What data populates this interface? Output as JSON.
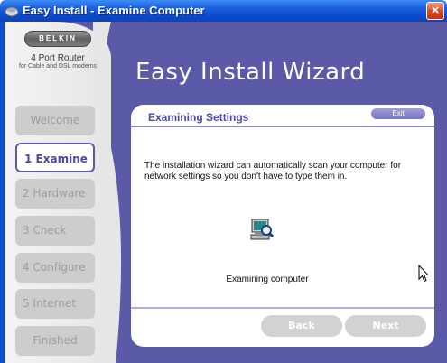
{
  "window": {
    "title": "Easy Install - Examine Computer",
    "close_label": "×"
  },
  "logo": {
    "brand": "BELKIN",
    "product": "4 Port Router",
    "subtitle": "for Cable and DSL modems"
  },
  "steps": [
    {
      "label": "Welcome",
      "state": "disabled"
    },
    {
      "label": "1 Examine",
      "state": "active"
    },
    {
      "label": "2 Hardware",
      "state": "disabled"
    },
    {
      "label": "3 Check",
      "state": "disabled"
    },
    {
      "label": "4 Configure",
      "state": "disabled"
    },
    {
      "label": "5 Internet",
      "state": "disabled"
    },
    {
      "label": "Finished",
      "state": "disabled"
    }
  ],
  "wizard_title": "Easy Install Wizard",
  "panel": {
    "title": "Examining Settings",
    "exit_label": "Exit",
    "body": "The installation wizard can automatically scan your computer for network settings so you don't have to type them in.",
    "status": "Examining computer",
    "back_label": "Back",
    "next_label": "Next"
  },
  "colors": {
    "accent": "#5a5aa8",
    "titlebar": "#0a4ccf",
    "disabled_button": "#d2d2d2"
  }
}
